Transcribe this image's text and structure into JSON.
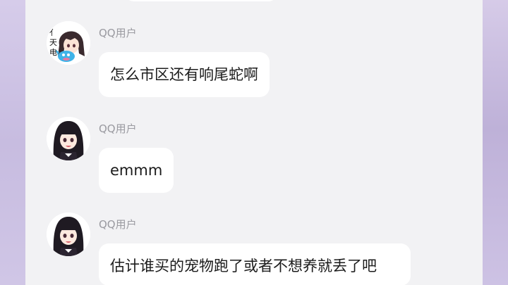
{
  "messages": [
    {
      "sender": "QQ用户",
      "text": "怎么市区还有响尾蛇啊",
      "avatar": "anime-girl-avatar"
    },
    {
      "sender": "QQ用户",
      "text": "emmm",
      "avatar": "dark-hair-girl-avatar"
    },
    {
      "sender": "QQ用户",
      "text": "估计谁买的宠物跑了或者不想养就丢了吧",
      "avatar": "dark-hair-girl-avatar"
    }
  ],
  "avatar_badge_text": "亻天电",
  "colors": {
    "screen_background": "#f2f2f4",
    "bubble": "#ffffff",
    "side_background": "#c9bfdc",
    "sender_name": "#9a9aa0"
  }
}
